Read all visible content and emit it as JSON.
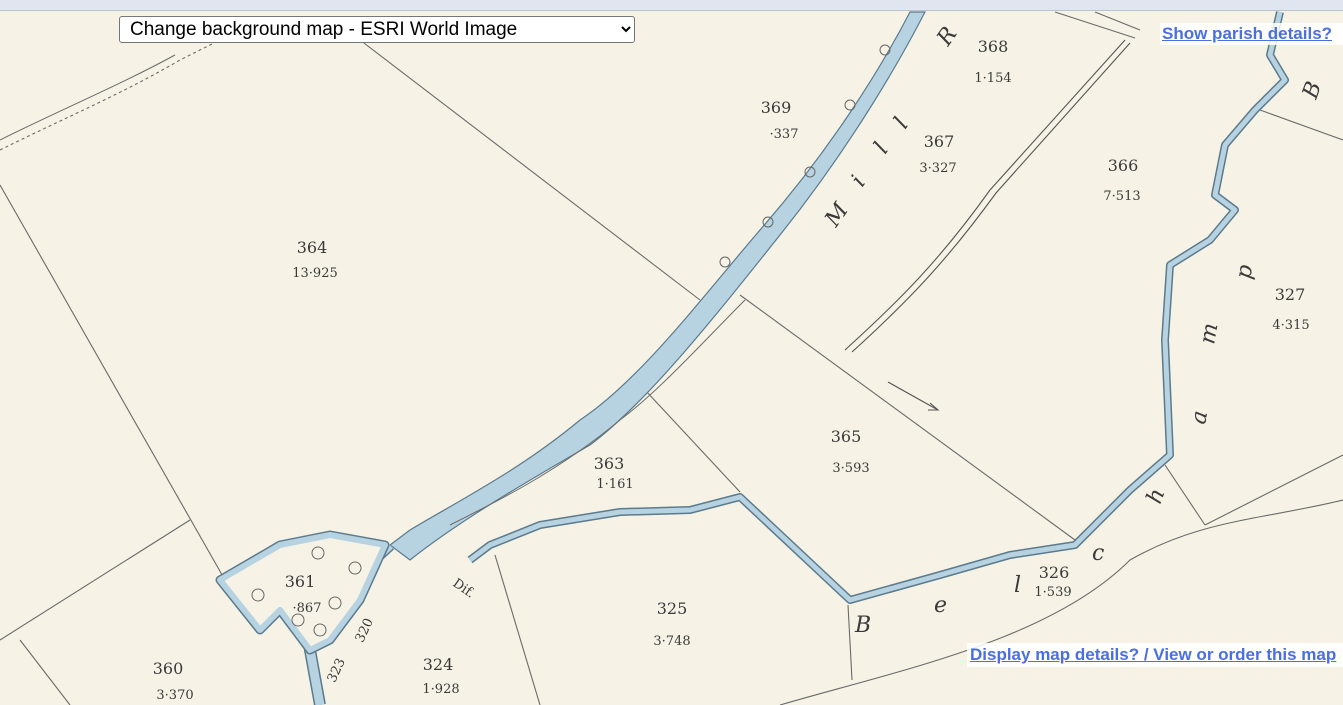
{
  "controls": {
    "background_select": {
      "label": "Change background map - ESRI World Image",
      "options": [
        "Change background map - ESRI World Image"
      ]
    },
    "show_parish_link": "Show parish details?",
    "display_details_link": "Display map details? / View or order this map"
  },
  "map": {
    "parcels": [
      {
        "number": "368",
        "area": "1·154"
      },
      {
        "number": "369",
        "area": "·337"
      },
      {
        "number": "367",
        "area": "3·327"
      },
      {
        "number": "366",
        "area": "7·513"
      },
      {
        "number": "364",
        "area": "13·925"
      },
      {
        "number": "327",
        "area": "4·315"
      },
      {
        "number": "365",
        "area": "3·593"
      },
      {
        "number": "363",
        "area": "1·161"
      },
      {
        "number": "361",
        "area": "·867"
      },
      {
        "number": "325",
        "area": "3·748"
      },
      {
        "number": "326",
        "area": "1·539"
      },
      {
        "number": "360",
        "area": "3·370"
      },
      {
        "number": "324",
        "area": "1·928"
      },
      {
        "number": "323",
        "area": ""
      },
      {
        "number": "320",
        "area": ""
      }
    ],
    "feature_letters": {
      "mill_race": [
        "M",
        "i",
        "l",
        "l",
        "R"
      ],
      "stream": [
        "B",
        "e",
        "l",
        "c",
        "h",
        "a",
        "m",
        "p",
        "B"
      ],
      "misc": "Dif."
    }
  },
  "colors": {
    "paper": "#f6f3e6",
    "water": "#b7d3e2",
    "ink": "#3a3a3a",
    "link": "#4a6fe0"
  }
}
